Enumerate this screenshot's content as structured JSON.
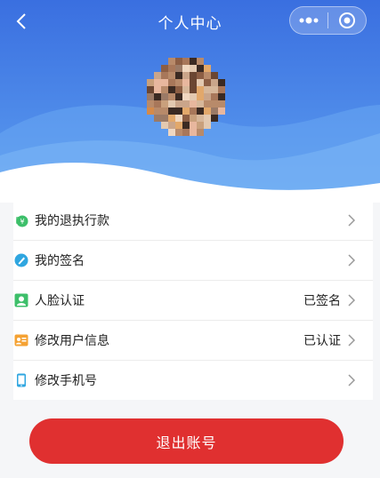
{
  "header": {
    "title": "个人中心",
    "back_icon": "chevron-left-icon",
    "capsule": {
      "more_icon": "more-dots-icon",
      "close_icon": "target-circle-icon"
    },
    "gradient_top": "#3a6fe0",
    "gradient_bottom": "#5fa1ee"
  },
  "avatar": {
    "pixelated": true
  },
  "menu": {
    "items": [
      {
        "label": "我的退执行款",
        "value": "",
        "icon": "money-bag-icon",
        "icon_color": "#3dbf6a"
      },
      {
        "label": "我的签名",
        "value": "",
        "icon": "pen-icon",
        "icon_color": "#2fa6e0"
      },
      {
        "label": "人脸认证",
        "value": "已签名",
        "icon": "face-id-icon",
        "icon_color": "#3dbf6a"
      },
      {
        "label": "修改用户信息",
        "value": "已认证",
        "icon": "user-card-icon",
        "icon_color": "#f5a233"
      },
      {
        "label": "修改手机号",
        "value": "",
        "icon": "phone-icon",
        "icon_color": "#2fa6e0"
      }
    ]
  },
  "logout": {
    "label": "退出账号",
    "color": "#e03030"
  }
}
